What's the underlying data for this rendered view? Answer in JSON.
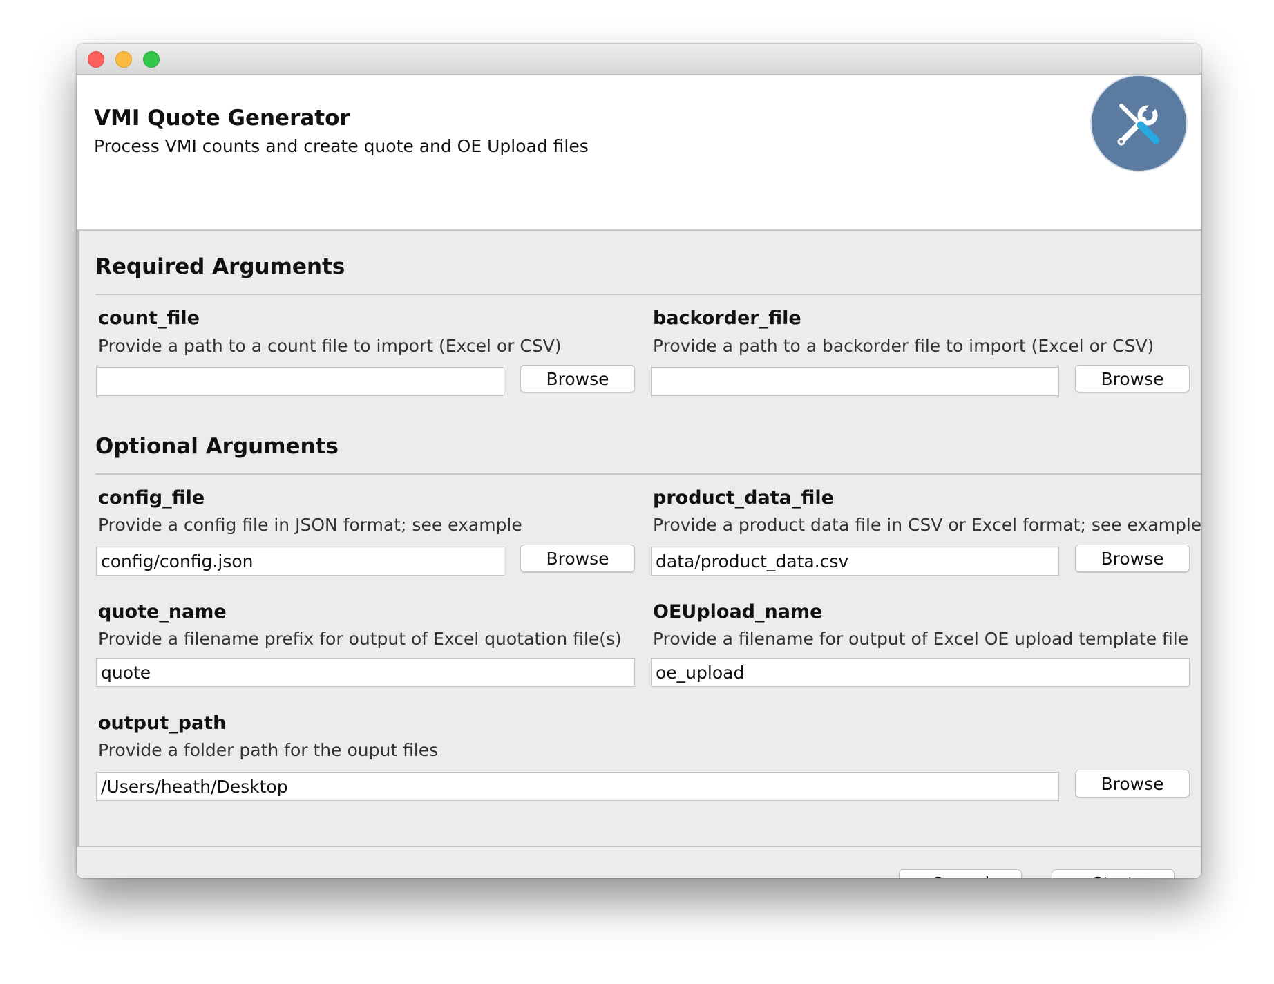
{
  "window": {
    "title": ""
  },
  "header": {
    "title": "VMI Quote Generator",
    "subtitle": "Process VMI counts and create quote and OE Upload files",
    "logo_icon": "tools-icon",
    "logo_color": "#5b7ba1"
  },
  "required": {
    "title": "Required Arguments",
    "count_file": {
      "name": "count_file",
      "help": "Provide a path to a count file to import (Excel or CSV)",
      "value": "",
      "browse_label": "Browse"
    },
    "backorder_file": {
      "name": "backorder_file",
      "help": "Provide a path to a backorder file to import (Excel or CSV)",
      "value": "",
      "browse_label": "Browse"
    }
  },
  "optional": {
    "title": "Optional Arguments",
    "config_file": {
      "name": "config_file",
      "help": "Provide a config file in JSON format; see example",
      "value": "config/config.json",
      "browse_label": "Browse"
    },
    "product_data_file": {
      "name": "product_data_file",
      "help": "Provide a product data file in CSV or Excel format; see example",
      "value": "data/product_data.csv",
      "browse_label": "Browse"
    },
    "quote_name": {
      "name": "quote_name",
      "help": "Provide a filename prefix for output of Excel quotation file(s)",
      "value": "quote"
    },
    "oeupload_name": {
      "name": "OEUpload_name",
      "help": "Provide a filename for output of Excel OE upload template file",
      "value": "oe_upload"
    },
    "output_path": {
      "name": "output_path",
      "help": "Provide a folder path for the ouput files",
      "value": "/Users/heath/Desktop",
      "browse_label": "Browse"
    }
  },
  "footer": {
    "cancel_label": "Cancel",
    "start_label": "Start"
  }
}
